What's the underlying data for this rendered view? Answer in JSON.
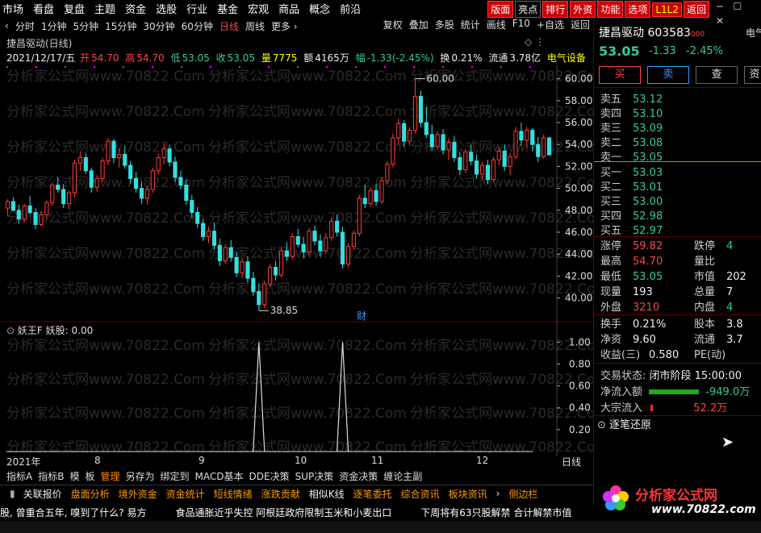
{
  "menubar": [
    "市场",
    "看盘",
    "复盘",
    "主题",
    "资金",
    "选股",
    "行业",
    "基金",
    "宏观",
    "商品",
    "概念",
    "前沿"
  ],
  "topbuttons": [
    "版面",
    "亮点",
    "排行",
    "外资",
    "功能",
    "选项",
    "L1L2",
    "返回"
  ],
  "periods": [
    "分时",
    "1分钟",
    "5分钟",
    "15分钟",
    "30分钟",
    "60分钟",
    "日线",
    "周线",
    "更多 ›"
  ],
  "active_period": "日线",
  "chart_tools": [
    "复权",
    "叠加",
    "多股",
    "统计",
    "画线",
    "F10",
    "+自选",
    "返回"
  ],
  "chart_title": "捷昌驱动(日线)",
  "quote": {
    "date": "2021/12/17/五",
    "open_label": "开",
    "open": "54.70",
    "high_label": "高",
    "high": "54.70",
    "low_label": "低",
    "low": "53.05",
    "close_label": "收",
    "close": "53.05",
    "vol_label": "量",
    "vol": "7775",
    "amount_label": "额",
    "amount": "4165万",
    "range_label": "幅",
    "range": "-1.33(-2.45%)",
    "turnover_label": "换",
    "turnover": "0.21%",
    "float_label": "流通",
    "float": "3.78亿",
    "sector": "电气设备"
  },
  "main_axis": [
    "60.00",
    "58.00",
    "56.00",
    "54.00",
    "52.00",
    "50.00",
    "48.00",
    "46.00",
    "44.00",
    "42.00",
    "40.00"
  ],
  "high_mark": "60.00",
  "low_mark": "38.85",
  "cai_label": "财",
  "sub_header": {
    "name": "妖王F",
    "item": "妖股:",
    "value": "0.00"
  },
  "sub_axis": [
    "1.00",
    "0.80",
    "0.60",
    "0.40",
    "0.20"
  ],
  "x_labels": [
    "2021年",
    "8",
    "9",
    "10",
    "11",
    "12"
  ],
  "x_unit": "日线",
  "indicator_tabs": [
    "指标A",
    "指标B",
    "模",
    "板",
    "管理",
    "另存为",
    "绑定到",
    "MACD基本",
    "DDE决策",
    "SUP决策",
    "资金决策",
    "缠论主副"
  ],
  "active_indicator_tab": "管理",
  "bottom_tabs": [
    "关联报价",
    "盘面分析",
    "境外资金",
    "资金统计",
    "短线情绪",
    "涨跌贡献",
    "相似K线",
    "逐笔委托",
    "综合资讯",
    "板块资讯",
    "›",
    "侧边栏"
  ],
  "ticker": [
    "股, 曾重合五年, 嗅到了什么? 易方",
    "食品通胀近乎失控 阿根廷政府限制玉米和小麦出口",
    "下周将有63只股解禁 合计解禁市值"
  ],
  "stock": {
    "name": "捷昌驱动",
    "code": "603583",
    "badge": "电气",
    "price": "53.05",
    "change": "-1.33",
    "change_pct": "-2.45%"
  },
  "actions": [
    "买",
    "卖",
    "查",
    "资"
  ],
  "asks": [
    {
      "label": "卖五",
      "price": "53.12"
    },
    {
      "label": "卖四",
      "price": "53.10"
    },
    {
      "label": "卖三",
      "price": "53.09"
    },
    {
      "label": "卖二",
      "price": "53.08"
    },
    {
      "label": "卖一",
      "price": "53.05"
    }
  ],
  "bids": [
    {
      "label": "买一",
      "price": "53.03"
    },
    {
      "label": "买二",
      "price": "53.01"
    },
    {
      "label": "买三",
      "price": "53.00"
    },
    {
      "label": "买四",
      "price": "52.98"
    },
    {
      "label": "买五",
      "price": "52.97"
    }
  ],
  "stats": {
    "limit_up_label": "涨停",
    "limit_up": "59.82",
    "limit_down_label": "跌停",
    "limit_down": "4",
    "high_label": "最高",
    "high": "54.70",
    "volume_ratio_label": "量比",
    "volume_ratio": "",
    "low_label": "最低",
    "low": "53.05",
    "mktcap_label": "市值",
    "mktcap": "202",
    "current_label": "现量",
    "current": "193",
    "total_label": "总量",
    "total": "7",
    "outer_label": "外盘",
    "outer": "3210",
    "inner_label": "内盘",
    "inner": "4"
  },
  "stats2": {
    "turnover_label": "换手",
    "turnover": "0.21%",
    "shares_label": "股本",
    "shares": "3.8",
    "nav_label": "净资",
    "nav": "9.60",
    "float_label": "流通",
    "float": "3.7",
    "eps_label": "收益(三)",
    "eps": "0.580",
    "pe_label": "PE(动)",
    "pe": ""
  },
  "trade_status": {
    "label": "交易状态:",
    "value": "闭市阶段 15:00:00"
  },
  "net_inflow": {
    "label": "净流入额",
    "value": "-949.0万"
  },
  "block_flow": {
    "label": "大宗流入",
    "value": "52.2万"
  },
  "tick_section": "逐笔还原",
  "logo": {
    "text": "分析家公式网",
    "url": "www.70822.com"
  },
  "watermark": "分析家公式网www.70822.Com",
  "colors": {
    "up": "#ff3b3b",
    "down": "#33e0e0",
    "bg": "#000000",
    "accent": "#ff4444"
  },
  "chart_data": {
    "type": "candlestick",
    "title": "捷昌驱动(日线)",
    "ylim": [
      38.5,
      61
    ],
    "high": 60.0,
    "low": 38.85,
    "candles": [
      [
        48.2,
        49.0,
        47.5,
        48.8
      ],
      [
        48.8,
        49.2,
        47.9,
        48.0
      ],
      [
        48.0,
        48.5,
        46.8,
        47.2
      ],
      [
        47.2,
        48.6,
        46.9,
        48.4
      ],
      [
        48.4,
        49.3,
        47.6,
        47.8
      ],
      [
        47.8,
        48.2,
        46.3,
        46.7
      ],
      [
        46.7,
        47.9,
        46.5,
        47.6
      ],
      [
        47.6,
        48.9,
        47.1,
        48.7
      ],
      [
        48.7,
        50.5,
        48.4,
        50.3
      ],
      [
        50.3,
        51.0,
        49.6,
        49.9
      ],
      [
        49.9,
        50.4,
        48.2,
        48.6
      ],
      [
        48.6,
        49.8,
        48.1,
        49.6
      ],
      [
        49.6,
        52.6,
        49.2,
        52.3
      ],
      [
        52.3,
        53.4,
        51.6,
        52.8
      ],
      [
        52.8,
        53.2,
        51.3,
        51.6
      ],
      [
        51.6,
        51.9,
        49.6,
        50.1
      ],
      [
        50.1,
        51.2,
        49.7,
        50.9
      ],
      [
        50.9,
        52.8,
        50.6,
        52.5
      ],
      [
        52.5,
        54.6,
        52.1,
        54.3
      ],
      [
        54.3,
        54.5,
        52.3,
        52.8
      ],
      [
        52.8,
        53.6,
        51.9,
        53.1
      ],
      [
        53.1,
        53.9,
        51.8,
        52.1
      ],
      [
        52.1,
        52.5,
        50.4,
        50.9
      ],
      [
        50.9,
        51.5,
        49.6,
        50.0
      ],
      [
        50.0,
        50.6,
        48.6,
        49.1
      ],
      [
        49.1,
        50.2,
        48.5,
        49.9
      ],
      [
        49.9,
        51.9,
        49.6,
        51.6
      ],
      [
        51.6,
        53.2,
        51.2,
        52.8
      ],
      [
        52.8,
        54.1,
        52.2,
        53.6
      ],
      [
        53.6,
        54.0,
        52.0,
        52.4
      ],
      [
        52.4,
        52.9,
        50.6,
        51.0
      ],
      [
        51.0,
        51.6,
        49.9,
        50.3
      ],
      [
        50.3,
        50.8,
        48.5,
        48.9
      ],
      [
        48.9,
        49.4,
        47.3,
        47.8
      ],
      [
        47.8,
        48.3,
        46.4,
        46.8
      ],
      [
        46.8,
        47.2,
        45.2,
        45.6
      ],
      [
        45.6,
        46.5,
        45.0,
        46.1
      ],
      [
        46.1,
        46.9,
        44.4,
        44.8
      ],
      [
        44.8,
        45.4,
        42.9,
        43.4
      ],
      [
        43.4,
        44.9,
        43.1,
        44.6
      ],
      [
        44.6,
        45.3,
        43.3,
        43.7
      ],
      [
        43.7,
        44.2,
        41.9,
        42.3
      ],
      [
        42.3,
        43.6,
        41.8,
        43.3
      ],
      [
        43.3,
        43.8,
        41.4,
        41.8
      ],
      [
        41.8,
        42.4,
        40.2,
        40.6
      ],
      [
        40.6,
        41.3,
        38.85,
        39.4
      ],
      [
        39.4,
        41.6,
        39.1,
        41.3
      ],
      [
        41.3,
        43.1,
        41.0,
        42.8
      ],
      [
        42.8,
        43.4,
        41.6,
        42.1
      ],
      [
        42.1,
        44.6,
        41.9,
        44.3
      ],
      [
        44.3,
        45.1,
        43.4,
        43.8
      ],
      [
        43.8,
        45.9,
        43.5,
        45.6
      ],
      [
        45.6,
        46.3,
        44.6,
        44.9
      ],
      [
        44.9,
        45.6,
        43.6,
        44.2
      ],
      [
        44.2,
        46.4,
        43.9,
        46.1
      ],
      [
        46.1,
        46.6,
        44.8,
        45.2
      ],
      [
        45.2,
        45.8,
        43.8,
        44.3
      ],
      [
        44.3,
        45.9,
        44.0,
        45.5
      ],
      [
        45.5,
        47.3,
        45.2,
        47.0
      ],
      [
        47.0,
        47.6,
        45.6,
        46.0
      ],
      [
        46.0,
        46.5,
        42.7,
        43.1
      ],
      [
        43.1,
        45.0,
        42.8,
        44.7
      ],
      [
        44.7,
        46.2,
        44.4,
        45.9
      ],
      [
        45.9,
        49.4,
        45.6,
        49.1
      ],
      [
        49.1,
        50.3,
        48.2,
        48.6
      ],
      [
        48.6,
        50.1,
        48.3,
        49.8
      ],
      [
        49.8,
        50.4,
        48.4,
        48.8
      ],
      [
        48.8,
        51.0,
        48.6,
        50.7
      ],
      [
        50.7,
        52.5,
        50.4,
        52.2
      ],
      [
        52.2,
        55.0,
        51.9,
        54.6
      ],
      [
        54.6,
        56.4,
        54.0,
        55.9
      ],
      [
        55.9,
        56.2,
        53.8,
        54.3
      ],
      [
        54.3,
        55.6,
        53.9,
        55.3
      ],
      [
        55.3,
        60.0,
        55.0,
        58.4
      ],
      [
        58.4,
        58.9,
        55.6,
        56.0
      ],
      [
        56.0,
        57.4,
        54.6,
        54.9
      ],
      [
        54.9,
        55.8,
        53.4,
        53.8
      ],
      [
        53.8,
        55.2,
        53.5,
        54.9
      ],
      [
        54.9,
        55.4,
        53.1,
        53.5
      ],
      [
        53.5,
        54.6,
        52.6,
        54.2
      ],
      [
        54.2,
        54.8,
        52.4,
        52.8
      ],
      [
        52.8,
        53.3,
        51.2,
        51.7
      ],
      [
        51.7,
        53.6,
        51.4,
        53.3
      ],
      [
        53.3,
        54.0,
        52.1,
        52.5
      ],
      [
        52.5,
        53.1,
        50.9,
        51.3
      ],
      [
        51.3,
        52.4,
        50.7,
        52.1
      ],
      [
        52.1,
        52.6,
        50.4,
        50.8
      ],
      [
        50.8,
        52.9,
        50.6,
        52.6
      ],
      [
        52.6,
        53.8,
        52.1,
        53.4
      ],
      [
        53.4,
        54.0,
        51.6,
        52.0
      ],
      [
        52.0,
        53.2,
        51.2,
        52.9
      ],
      [
        52.9,
        55.6,
        52.6,
        55.2
      ],
      [
        55.2,
        56.0,
        53.9,
        54.4
      ],
      [
        54.4,
        55.6,
        53.6,
        55.3
      ],
      [
        55.3,
        55.5,
        53.4,
        54.0
      ],
      [
        54.0,
        54.7,
        52.4,
        52.9
      ],
      [
        52.9,
        54.9,
        52.7,
        54.6
      ],
      [
        54.6,
        54.7,
        53.05,
        53.05
      ]
    ],
    "signal_peaks": [
      {
        "x_index": 45,
        "value": 1.0
      },
      {
        "x_index": 60,
        "value": 1.0
      }
    ],
    "sub_ylim": [
      0,
      1.15
    ]
  }
}
